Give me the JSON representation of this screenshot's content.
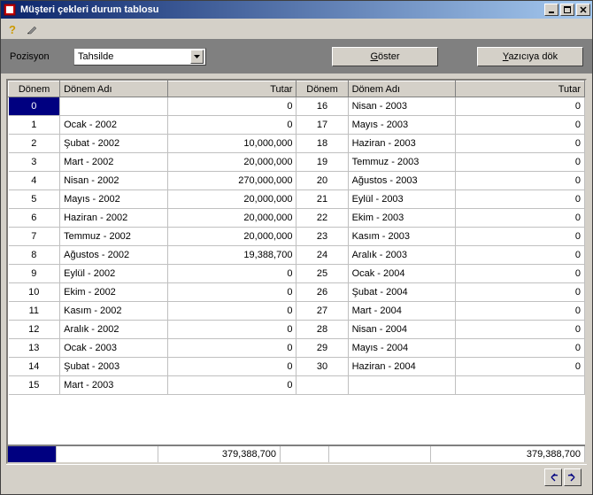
{
  "window": {
    "title": "Müşteri çekleri durum tablosu"
  },
  "filter": {
    "label": "Pozisyon",
    "value": "Tahsilde"
  },
  "buttons": {
    "show": "Göster",
    "print": "Yazıcıya dök"
  },
  "columns": {
    "donem": "Dönem",
    "donemadi": "Dönem Adı",
    "tutar": "Tutar"
  },
  "rows_left": [
    {
      "d": "0",
      "n": "",
      "t": "0"
    },
    {
      "d": "1",
      "n": "Ocak   - 2002",
      "t": "0"
    },
    {
      "d": "2",
      "n": "Şubat  - 2002",
      "t": "10,000,000"
    },
    {
      "d": "3",
      "n": "Mart   - 2002",
      "t": "20,000,000"
    },
    {
      "d": "4",
      "n": "Nisan  - 2002",
      "t": "270,000,000"
    },
    {
      "d": "5",
      "n": "Mayıs  - 2002",
      "t": "20,000,000"
    },
    {
      "d": "6",
      "n": "Haziran - 2002",
      "t": "20,000,000"
    },
    {
      "d": "7",
      "n": "Temmuz - 2002",
      "t": "20,000,000"
    },
    {
      "d": "8",
      "n": "Ağustos - 2002",
      "t": "19,388,700"
    },
    {
      "d": "9",
      "n": "Eylül   - 2002",
      "t": "0"
    },
    {
      "d": "10",
      "n": "Ekim   - 2002",
      "t": "0"
    },
    {
      "d": "11",
      "n": "Kasım  - 2002",
      "t": "0"
    },
    {
      "d": "12",
      "n": "Aralık  - 2002",
      "t": "0"
    },
    {
      "d": "13",
      "n": "Ocak   - 2003",
      "t": "0"
    },
    {
      "d": "14",
      "n": "Şubat  - 2003",
      "t": "0"
    },
    {
      "d": "15",
      "n": "Mart   - 2003",
      "t": "0"
    }
  ],
  "rows_right": [
    {
      "d": "16",
      "n": "Nisan  - 2003",
      "t": "0"
    },
    {
      "d": "17",
      "n": "Mayıs  - 2003",
      "t": "0"
    },
    {
      "d": "18",
      "n": "Haziran - 2003",
      "t": "0"
    },
    {
      "d": "19",
      "n": "Temmuz - 2003",
      "t": "0"
    },
    {
      "d": "20",
      "n": "Ağustos - 2003",
      "t": "0"
    },
    {
      "d": "21",
      "n": "Eylül   - 2003",
      "t": "0"
    },
    {
      "d": "22",
      "n": "Ekim   - 2003",
      "t": "0"
    },
    {
      "d": "23",
      "n": "Kasım  - 2003",
      "t": "0"
    },
    {
      "d": "24",
      "n": "Aralık  - 2003",
      "t": "0"
    },
    {
      "d": "25",
      "n": "Ocak   - 2004",
      "t": "0"
    },
    {
      "d": "26",
      "n": "Şubat  - 2004",
      "t": "0"
    },
    {
      "d": "27",
      "n": "Mart   - 2004",
      "t": "0"
    },
    {
      "d": "28",
      "n": "Nisan  - 2004",
      "t": "0"
    },
    {
      "d": "29",
      "n": "Mayıs  - 2004",
      "t": "0"
    },
    {
      "d": "30",
      "n": "Haziran - 2004",
      "t": "0"
    },
    {
      "d": "",
      "n": "",
      "t": ""
    }
  ],
  "totals": {
    "left": "379,388,700",
    "right": "379,388,700"
  }
}
